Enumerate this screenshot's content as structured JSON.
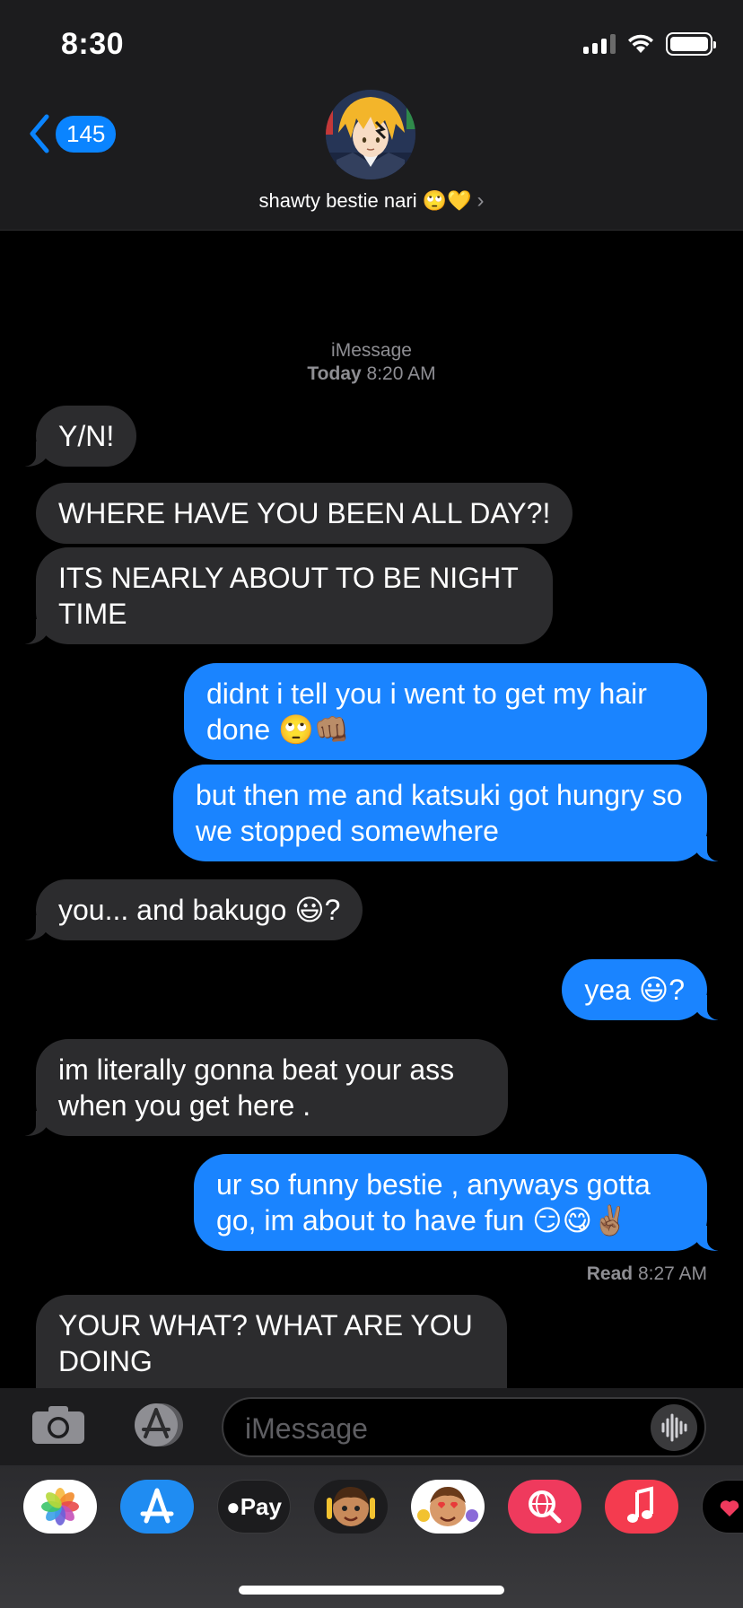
{
  "status": {
    "time": "8:30"
  },
  "header": {
    "badge_count": "145",
    "contact_name": "shawty bestie nari 🙄💛",
    "chevron": "›"
  },
  "thread": {
    "service": "iMessage",
    "date_label": "Today",
    "date_time": "8:20 AM",
    "messages": [
      {
        "from": "them",
        "text": "Y/N!"
      },
      {
        "from": "them",
        "text": "WHERE HAVE YOU BEEN ALL DAY?!"
      },
      {
        "from": "them",
        "text": "ITS NEARLY ABOUT TO BE NIGHT TIME"
      },
      {
        "from": "me",
        "text": "didnt i tell you i went to get my hair done 🙄👊🏽"
      },
      {
        "from": "me",
        "text": "but then me and katsuki got hungry so we stopped somewhere"
      },
      {
        "from": "them",
        "text": "you... and bakugo 😃?"
      },
      {
        "from": "me",
        "text": "yea 😃?"
      },
      {
        "from": "them",
        "text": "im literally gonna beat your ass when you get here ."
      },
      {
        "from": "me",
        "text": "ur so funny bestie , anyways gotta go, im about to have fun 😏😋✌🏽"
      },
      {
        "from": "them",
        "text": "YOUR WHAT? WHAT ARE YOU DOING"
      }
    ],
    "read_label": "Read",
    "read_time": "8:27 AM"
  },
  "composer": {
    "placeholder": "iMessage"
  },
  "drawer": {
    "apps": [
      "photos-app",
      "app-store-app",
      "apple-pay-app",
      "memoji-app",
      "animoji-app",
      "images-search-app",
      "music-app",
      "digital-touch-app"
    ],
    "apple_pay_label": "Pay"
  },
  "colors": {
    "outgoing": "#1a84ff",
    "incoming": "#2c2c2e",
    "accent": "#0a84ff"
  }
}
